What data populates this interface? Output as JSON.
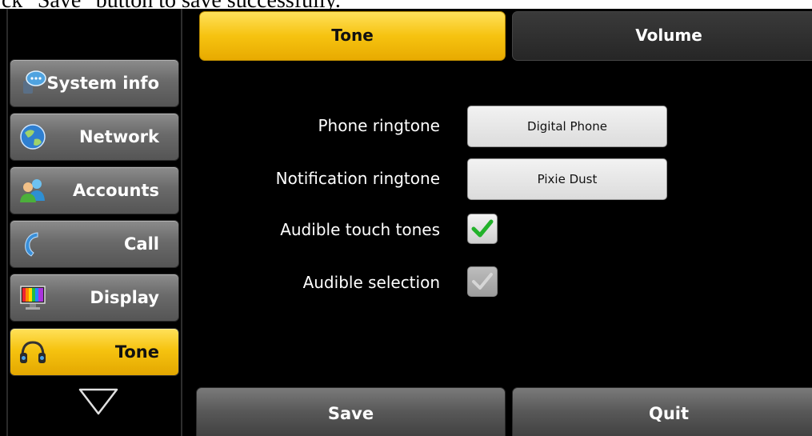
{
  "caption": "ck \"Save\" button to save successfully.",
  "sidebar": {
    "items": [
      {
        "label": "System info",
        "icon": "chat-bubble-icon",
        "active": false
      },
      {
        "label": "Network",
        "icon": "globe-icon",
        "active": false
      },
      {
        "label": "Accounts",
        "icon": "users-icon",
        "active": false
      },
      {
        "label": "Call",
        "icon": "handset-icon",
        "active": false
      },
      {
        "label": "Display",
        "icon": "monitor-icon",
        "active": false
      },
      {
        "label": "Tone",
        "icon": "headphones-icon",
        "active": true
      }
    ],
    "more_icon": "chevron-down-icon"
  },
  "tabs": [
    {
      "label": "Tone",
      "active": true
    },
    {
      "label": "Volume",
      "active": false
    }
  ],
  "settings": {
    "phone_ringtone": {
      "label": "Phone ringtone",
      "value": "Digital Phone"
    },
    "notification_ringtone": {
      "label": "Notification ringtone",
      "value": "Pixie Dust"
    },
    "audible_touch_tones": {
      "label": "Audible touch tones",
      "checked": true,
      "enabled": true
    },
    "audible_selection": {
      "label": "Audible selection",
      "checked": true,
      "enabled": false
    }
  },
  "actions": {
    "save_label": "Save",
    "quit_label": "Quit"
  },
  "colors": {
    "accent_yellow": "#f6c310",
    "checkmark_green": "#22b22a",
    "background": "#000000"
  }
}
